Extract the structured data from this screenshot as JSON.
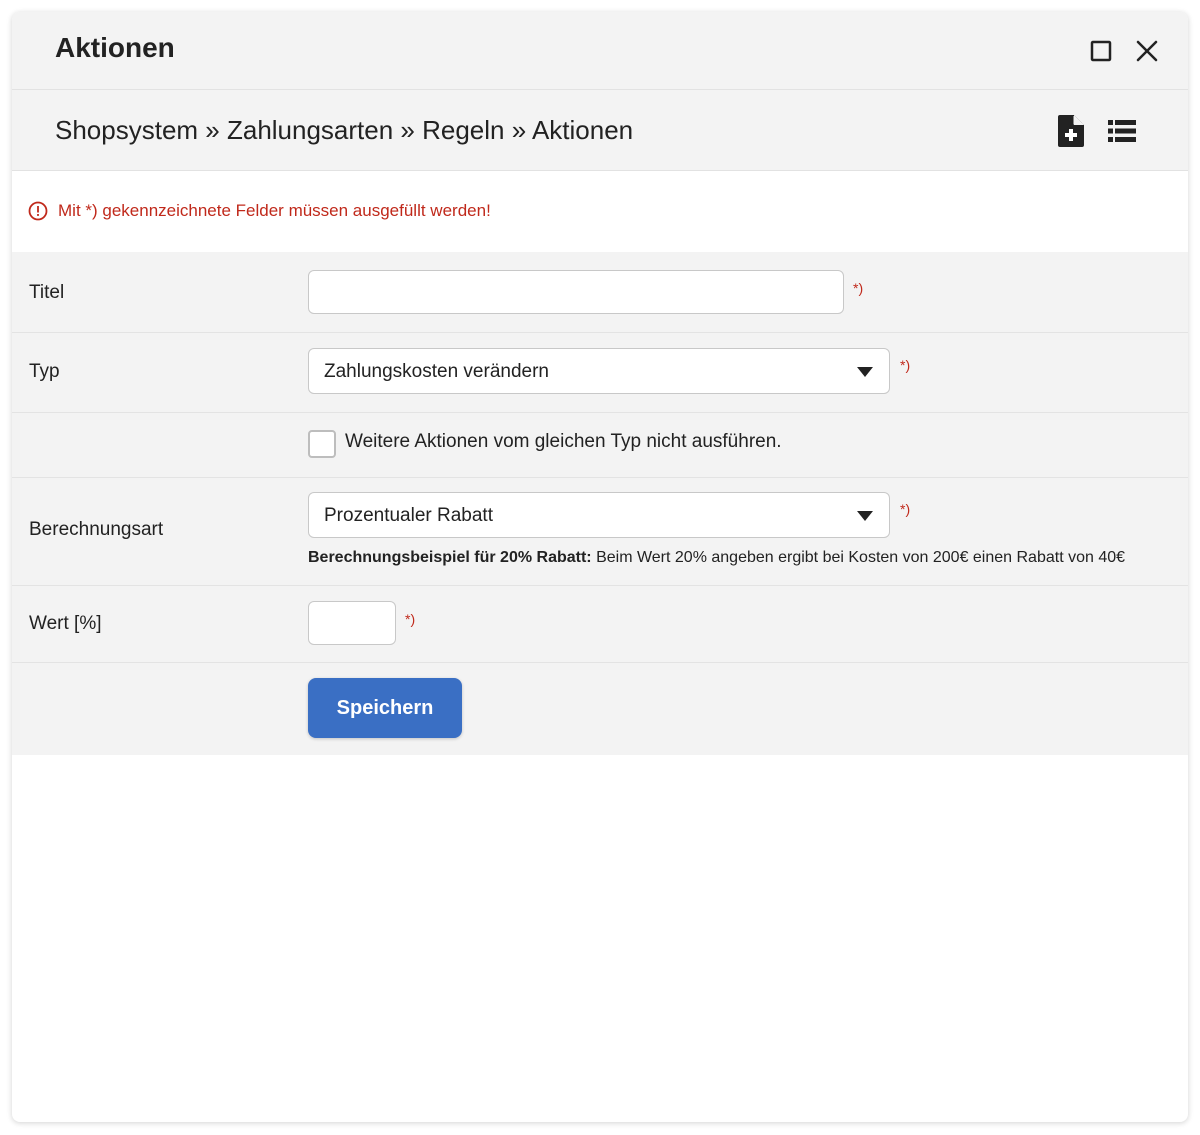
{
  "window": {
    "title": "Aktionen",
    "maximize_icon": "maximize-icon",
    "close_icon": "close-icon"
  },
  "breadcrumb": {
    "text": "Shopsystem » Zahlungsarten » Regeln » Aktionen",
    "tools": [
      "new-document-icon",
      "list-icon"
    ]
  },
  "notice": {
    "text": "Mit *) gekennzeichnete Felder müssen ausgefüllt werden!",
    "icon": "alert-circle-icon",
    "color": "#c0291b"
  },
  "form": {
    "titel": {
      "label": "Titel",
      "value": "",
      "required": "*)"
    },
    "typ": {
      "label": "Typ",
      "selected": "Zahlungskosten verändern",
      "required": "*)"
    },
    "checkbox": {
      "label": "Weitere Aktionen vom gleichen Typ nicht ausführen.",
      "checked": false
    },
    "berechnungsart": {
      "label": "Berechnungsart",
      "selected": "Prozentualer Rabatt",
      "required": "*)",
      "hint_bold": "Berechnungsbeispiel für 20% Rabatt:",
      "hint_text": " Beim Wert 20% angeben ergibt bei Kosten von 200€ einen Rabatt von 40€"
    },
    "wert": {
      "label": "Wert [%]",
      "value": "",
      "required": "*)"
    },
    "save_label": "Speichern"
  },
  "colors": {
    "accent": "#3a6fc4",
    "error": "#c0291b",
    "panel_bg": "#f3f3f3"
  }
}
